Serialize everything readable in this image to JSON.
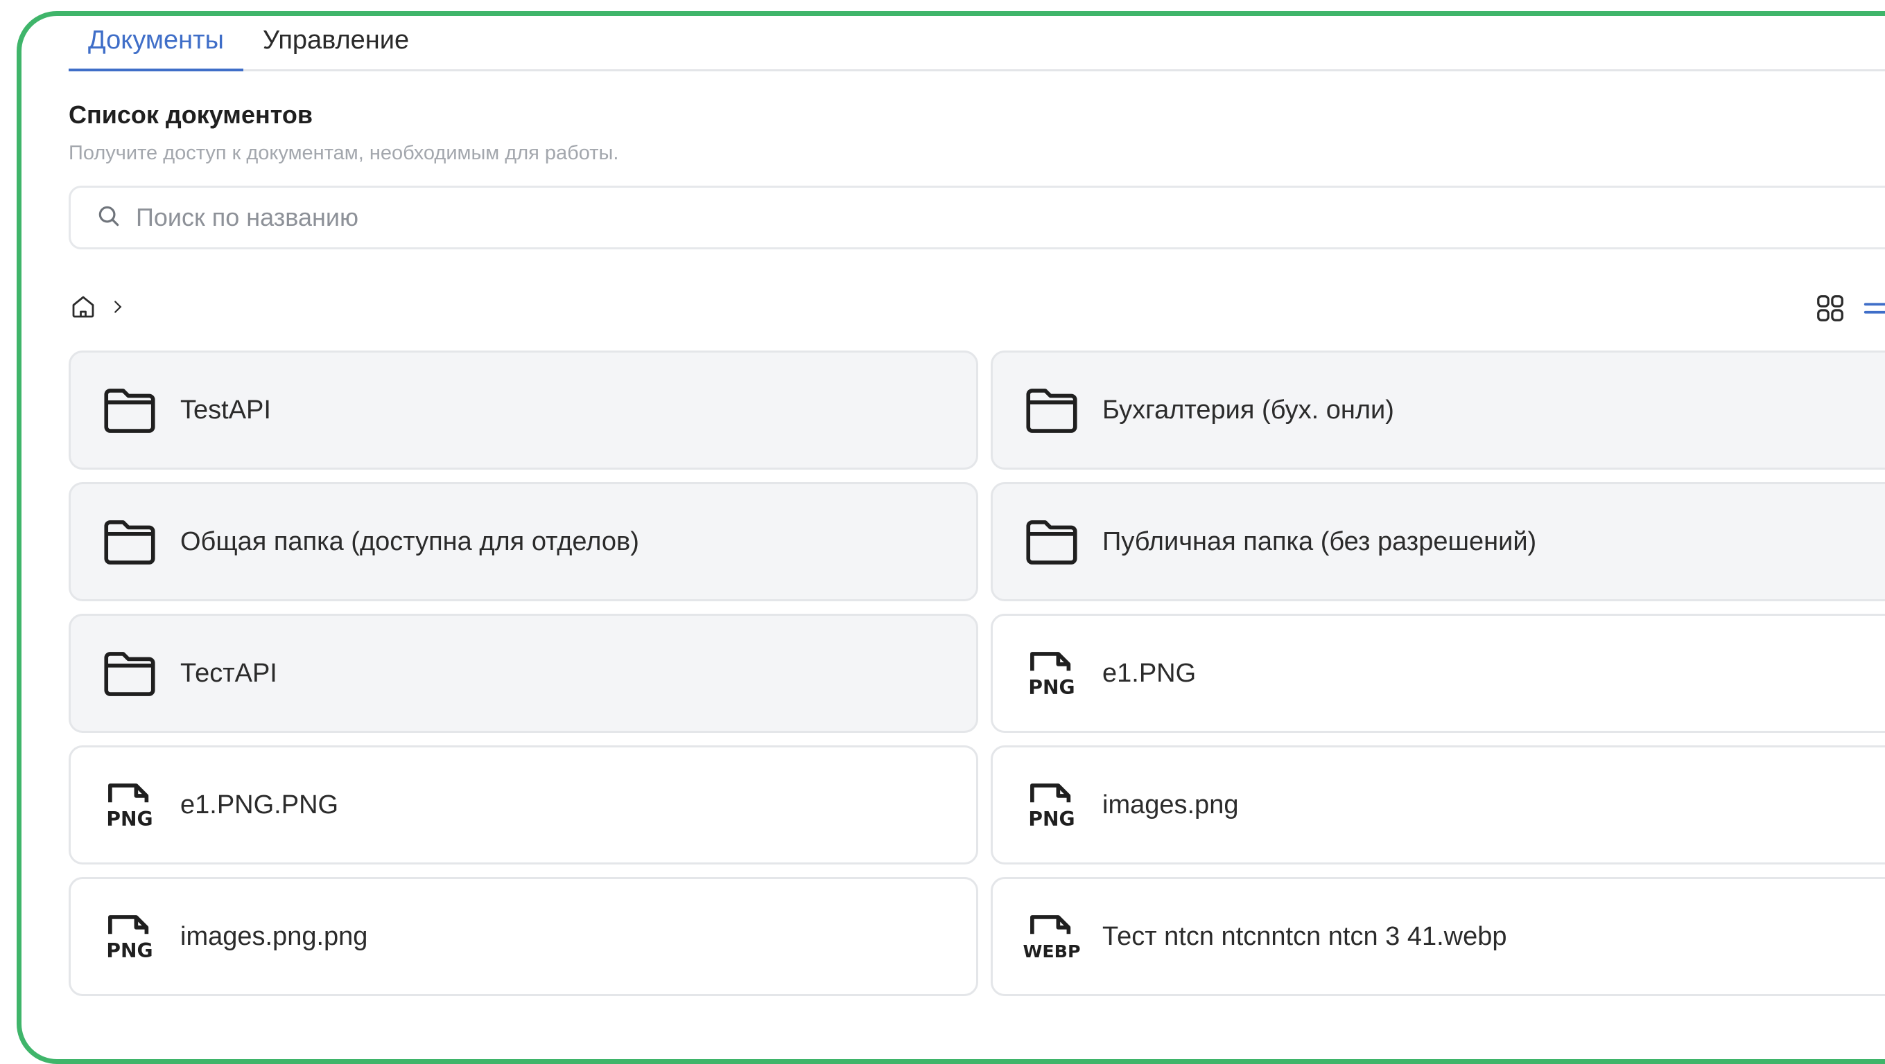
{
  "tabs": [
    {
      "label": "Документы",
      "active": true
    },
    {
      "label": "Управление",
      "active": false
    }
  ],
  "header": {
    "title": "Список документов",
    "subtitle": "Получите доступ к документам, необходимым для работы."
  },
  "search": {
    "placeholder": "Поиск по названию",
    "value": "",
    "icon": "search-icon"
  },
  "breadcrumb": {
    "home_icon": "home-icon",
    "separator_icon": "chevron-right-icon"
  },
  "view_toggle": {
    "grid_icon": "grid-view-icon",
    "list_icon": "list-view-icon"
  },
  "items": [
    {
      "name": "TestAPI",
      "kind": "folder"
    },
    {
      "name": "Бухгалтерия (бух. онли)",
      "kind": "folder"
    },
    {
      "name": "Общая папка (доступна для отделов)",
      "kind": "folder"
    },
    {
      "name": "Публичная папка (без разрешений)",
      "kind": "folder"
    },
    {
      "name": "ТестAPI",
      "kind": "folder"
    },
    {
      "name": "e1.PNG",
      "kind": "file",
      "ext": "PNG"
    },
    {
      "name": "e1.PNG.PNG",
      "kind": "file",
      "ext": "PNG"
    },
    {
      "name": "images.png",
      "kind": "file",
      "ext": "PNG"
    },
    {
      "name": "images.png.png",
      "kind": "file",
      "ext": "PNG"
    },
    {
      "name": "Тест ntcn ntcnntcn ntcn 3 41.webp",
      "kind": "file",
      "ext": "WEBP"
    }
  ],
  "colors": {
    "frame_border": "#3fb56a",
    "active_tab": "#3f6ec8",
    "folder_bg": "#f4f5f7",
    "file_bg": "#ffffff",
    "border": "#e4e6e9"
  }
}
